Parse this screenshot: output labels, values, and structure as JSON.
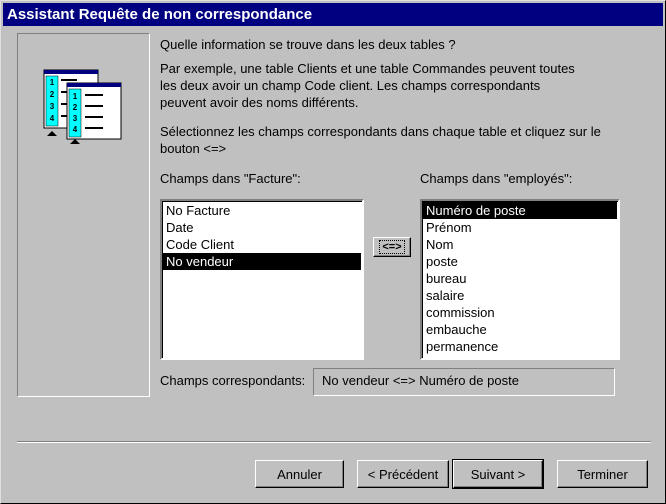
{
  "window": {
    "title": "Assistant Requête de non correspondance"
  },
  "intro": {
    "question": "Quelle information se trouve dans les deux tables ?",
    "example": "Par exemple, une table Clients et une table Commandes peuvent toutes\nles deux avoir un champ Code client. Les champs correspondants\npeuvent avoir des noms différents.",
    "instruction": "Sélectionnez les champs correspondants dans chaque table et cliquez sur le\nbouton <=>"
  },
  "illustration": {
    "front_numbers": [
      "1",
      "2",
      "3",
      "4"
    ],
    "back_numbers": [
      "1",
      "2",
      "3",
      "4"
    ]
  },
  "left_list": {
    "label": "Champs dans \"Facture\":",
    "items": [
      "No Facture",
      "Date",
      "Code Client",
      "No vendeur"
    ],
    "selected_index": 3
  },
  "right_list": {
    "label": "Champs dans \"employés\":",
    "items": [
      "Numéro de poste",
      "Prénom",
      "Nom",
      "poste",
      "bureau",
      "salaire",
      "commission",
      "embauche",
      "permanence"
    ],
    "selected_index": 0
  },
  "swap_button": {
    "label": "<=>"
  },
  "matching": {
    "label": "Champs correspondants:",
    "value": "No vendeur <=> Numéro de poste"
  },
  "buttons": {
    "cancel": "Annuler",
    "previous": "< Précédent",
    "next": "Suivant >",
    "finish": "Terminer"
  },
  "colors": {
    "titlebar": "#000080",
    "face": "#c0c0c0",
    "illustration_accent": "#00ffff"
  }
}
